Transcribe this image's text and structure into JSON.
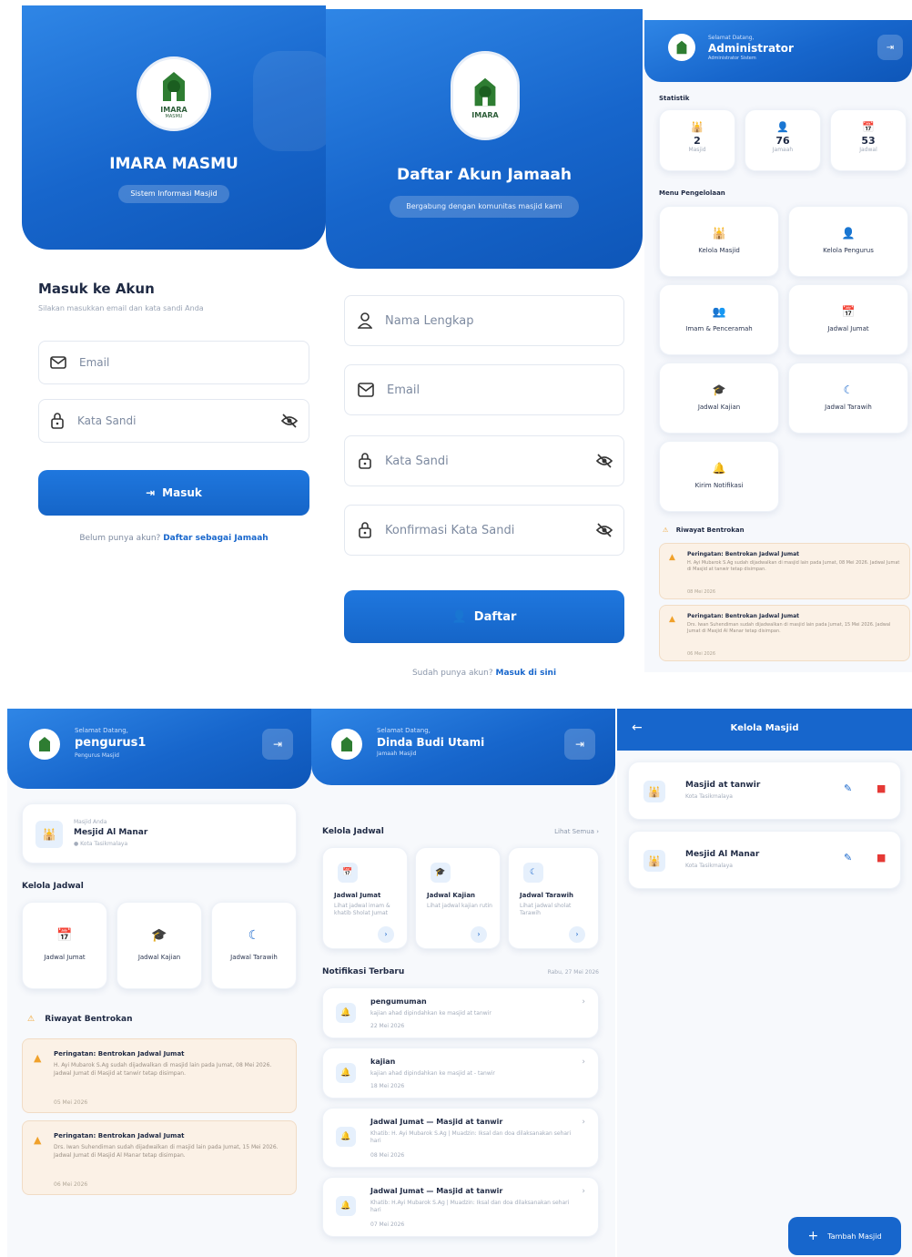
{
  "login": {
    "app_name": "IMARA MASMU",
    "badge": "Sistem Informasi Masjid",
    "heading": "Masuk ke Akun",
    "subheading": "Silakan masukkan email dan kata sandi Anda",
    "email_placeholder": "Email",
    "password_placeholder": "Kata Sandi",
    "submit_label": "Masuk",
    "footer_prefix": "Belum punya akun?",
    "footer_link": "Daftar sebagai Jamaah"
  },
  "register": {
    "title": "Daftar Akun Jamaah",
    "subtitle": "Bergabung dengan komunitas masjid kami",
    "name_placeholder": "Nama Lengkap",
    "email_placeholder": "Email",
    "password_placeholder": "Kata Sandi",
    "confirm_placeholder": "Konfirmasi Kata Sandi",
    "submit_label": "Daftar",
    "footer_prefix": "Sudah punya akun?",
    "footer_link": "Masuk di sini"
  },
  "admin": {
    "greeting": "Selamat Datang,",
    "name": "Administrator",
    "role": "Administrator Sistem",
    "stats_title": "Statistik",
    "stats": [
      {
        "icon": "mosque-icon",
        "value": "2",
        "label": "Masjid"
      },
      {
        "icon": "user-icon",
        "value": "76",
        "label": "Jamaah"
      },
      {
        "icon": "calendar-icon",
        "value": "53",
        "label": "Jadwal"
      }
    ],
    "menu_title": "Menu Pengelolaan",
    "menu": [
      {
        "icon": "mosque-icon",
        "label": "Kelola Masjid"
      },
      {
        "icon": "user-gear-icon",
        "label": "Kelola Pengurus"
      },
      {
        "icon": "users-icon",
        "label": "Imam & Penceramah"
      },
      {
        "icon": "calendar-icon",
        "label": "Jadwal Jumat"
      },
      {
        "icon": "graduation-cap-icon",
        "label": "Jadwal Kajian"
      },
      {
        "icon": "moon-icon",
        "label": "Jadwal Tarawih"
      },
      {
        "icon": "bell-icon",
        "label": "Kirim Notifikasi"
      }
    ],
    "conflict_title": "Riwayat Bentrokan",
    "conflicts": [
      {
        "title": "Peringatan: Bentrokan Jadwal Jumat",
        "body": "H. Ayi Mubarok S.Ag sudah dijadwalkan di masjid lain pada Jumat, 08 Mei 2026. Jadwal Jumat di Masjid at tanwir tetap disimpan.",
        "date": "08 Mei 2026"
      },
      {
        "title": "Peringatan: Bentrokan Jadwal Jumat",
        "body": "Drs. Iwan Suhendiman sudah dijadwalkan di masjid lain pada Jumat, 15 Mei 2026. Jadwal Jumat di Masjid Al Manar tetap disimpan.",
        "date": "06 Mei 2026"
      }
    ]
  },
  "pengurus": {
    "greeting": "Selamat Datang,",
    "name": "pengurus1",
    "role": "Pengurus Masjid",
    "mosque_caption": "Masjid Anda",
    "mosque_name": "Mesjid Al Manar",
    "mosque_location": "Kota Tasikmalaya",
    "schedule_title": "Kelola Jadwal",
    "schedules": [
      {
        "icon": "calendar-icon",
        "label": "Jadwal Jumat"
      },
      {
        "icon": "graduation-cap-icon",
        "label": "Jadwal Kajian"
      },
      {
        "icon": "moon-icon",
        "label": "Jadwal Tarawih"
      }
    ],
    "conflict_title": "Riwayat Bentrokan",
    "conflicts": [
      {
        "title": "Peringatan: Bentrokan Jadwal Jumat",
        "body": "H. Ayi Mubarok S.Ag sudah dijadwalkan di masjid lain pada Jumat, 08 Mei 2026. Jadwal Jumat di Masjid at tanwir tetap disimpan.",
        "date": "05 Mei 2026"
      },
      {
        "title": "Peringatan: Bentrokan Jadwal Jumat",
        "body": "Drs. Iwan Suhendiman sudah dijadwalkan di masjid lain pada Jumat, 15 Mei 2026. Jadwal Jumat di Masjid Al Manar tetap disimpan.",
        "date": "06 Mei 2026"
      }
    ]
  },
  "jamaah": {
    "greeting": "Selamat Datang,",
    "name": "Dinda Budi Utami",
    "role": "Jamaah Masjid",
    "schedule_title": "Kelola Jadwal",
    "see_all": "Lihat Semua",
    "schedules": [
      {
        "icon": "calendar-icon",
        "label": "Jadwal Jumat",
        "desc": "Lihat jadwal imam & khatib Sholat Jumat"
      },
      {
        "icon": "graduation-cap-icon",
        "label": "Jadwal Kajian",
        "desc": "Lihat jadwal kajian rutin"
      },
      {
        "icon": "moon-icon",
        "label": "Jadwal Tarawih",
        "desc": "Lihat jadwal sholat Tarawih"
      }
    ],
    "notif_title": "Notifikasi Terbaru",
    "notif_date": "Rabu, 27 Mei 2026",
    "notifications": [
      {
        "title": "pengumuman",
        "body": "kajian ahad dipindahkan ke masjid at tanwir",
        "date": "22 Mei 2026"
      },
      {
        "title": "kajian",
        "body": "kajian ahad dipindahkan ke masjid at - tanwir",
        "date": "18 Mei 2026"
      },
      {
        "title": "Jadwal Jumat — Masjid at tanwir",
        "body": "Khatib: H. Ayi Mubarok S.Ag | Muadzin: Iksal dan doa dilaksanakan sehari hari",
        "date": "08 Mei 2026"
      },
      {
        "title": "Jadwal Jumat — Masjid at tanwir",
        "body": "Khatib: H.Ayi Mubarok S.Ag | Muadzin: Iksal dan doa dilaksanakan sehari hari",
        "date": "07 Mei 2026"
      }
    ]
  },
  "kelola": {
    "title": "Kelola Masjid",
    "mosques": [
      {
        "name": "Masjid at tanwir",
        "city": "Kota Tasikmalaya"
      },
      {
        "name": "Mesjid Al Manar",
        "city": "Kota Tasikmalaya"
      }
    ],
    "add_label": "Tambah Masjid"
  },
  "logo": {
    "text": "IMARA",
    "sub": "MASMU"
  },
  "colors": {
    "primary": "#1766cc",
    "warning": "#f0a12b",
    "danger": "#e53935"
  }
}
